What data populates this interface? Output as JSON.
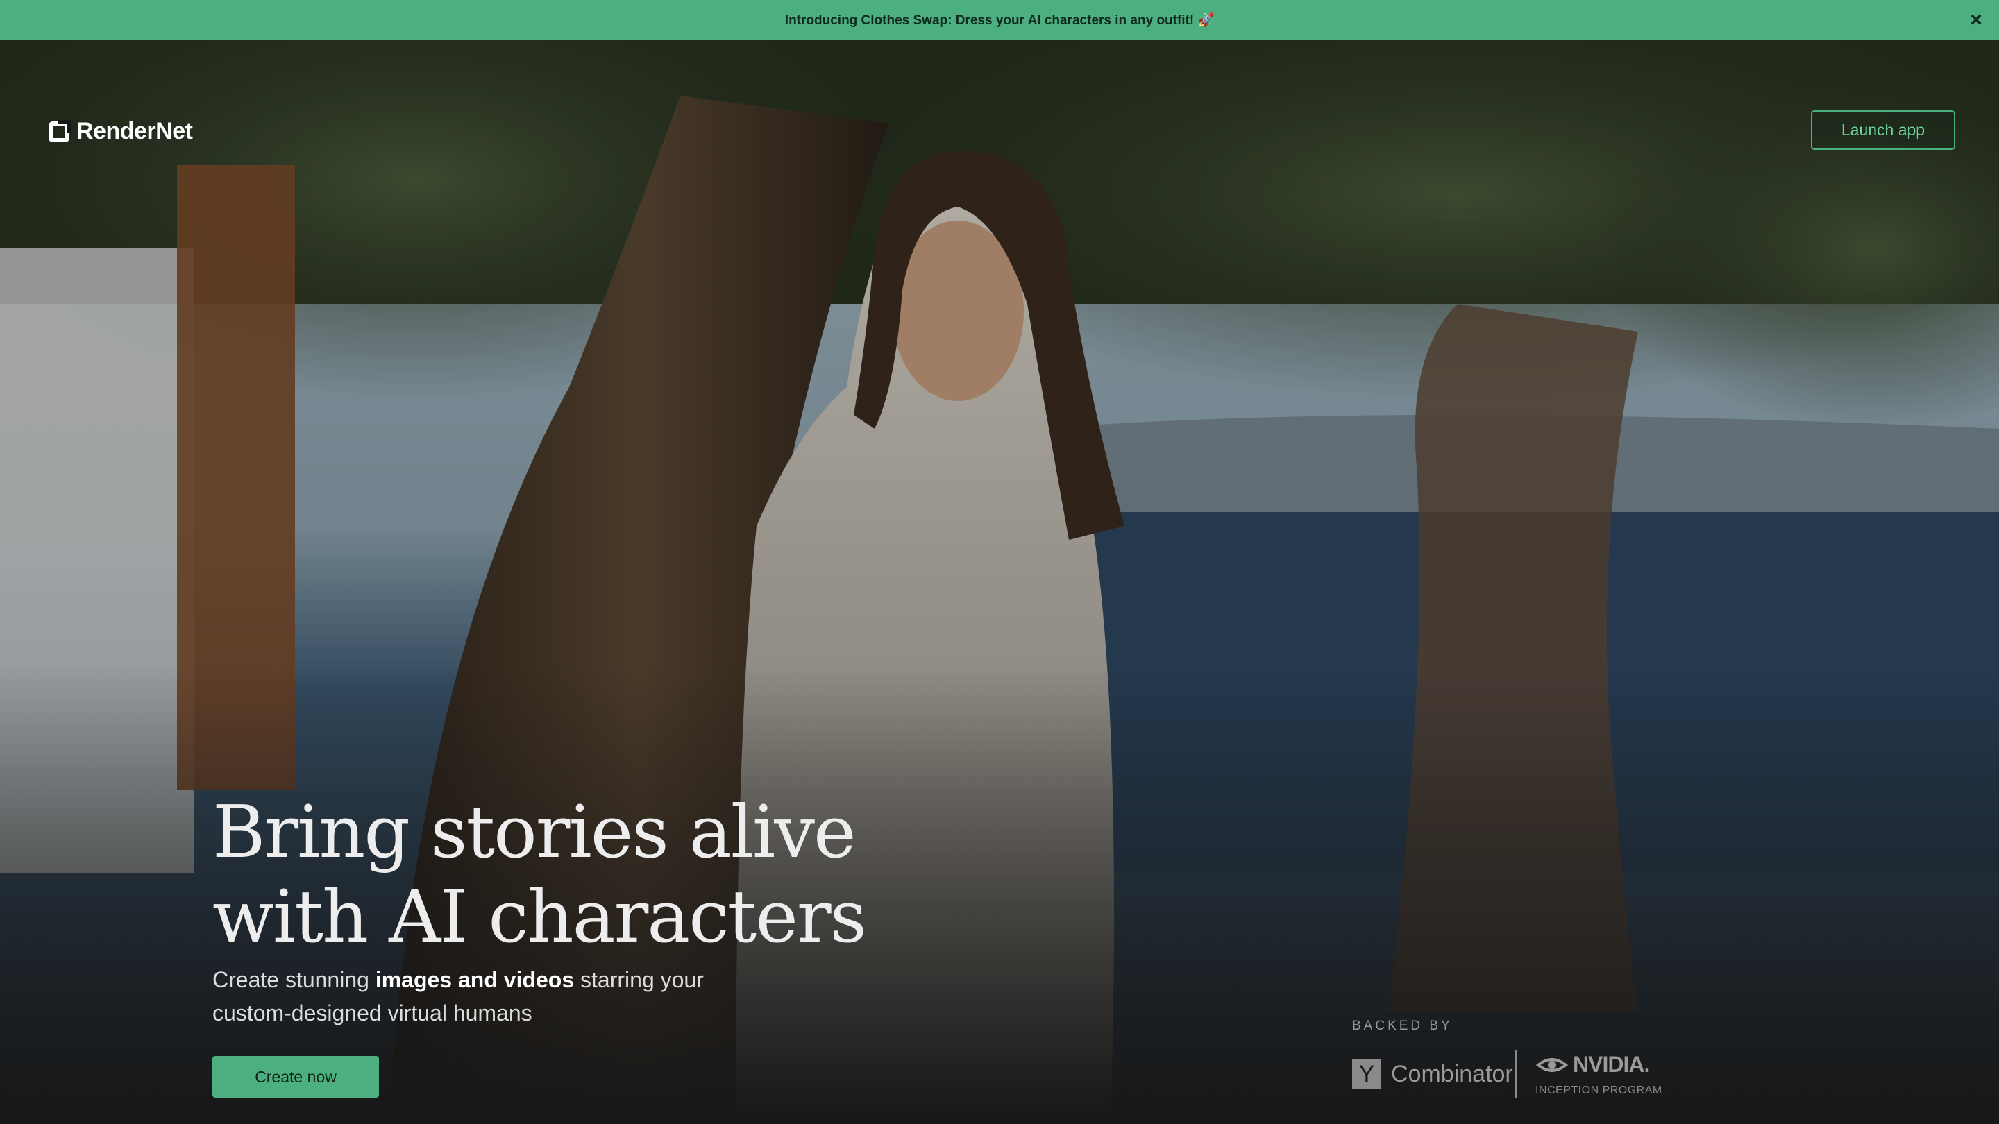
{
  "banner": {
    "text": "Introducing Clothes Swap: Dress your AI characters in any outfit! 🚀",
    "close_icon": "×"
  },
  "header": {
    "logo_text": "RenderNet",
    "launch_label": "Launch app"
  },
  "hero": {
    "headline_line1": "Bring stories alive",
    "headline_line2": "with AI characters",
    "subtitle_pre": "Create stunning ",
    "subtitle_bold": "images and videos",
    "subtitle_post": " starring your custom-designed virtual humans",
    "cta_label": "Create now"
  },
  "backers": {
    "label": "BACKED BY",
    "yc_letter": "Y",
    "yc_text": "Combinator",
    "nvidia_text": "NVIDIA.",
    "nvidia_sub": "INCEPTION PROGRAM"
  },
  "colors": {
    "accent": "#4caf7f",
    "background": "#171717",
    "headline": "#ededed"
  }
}
